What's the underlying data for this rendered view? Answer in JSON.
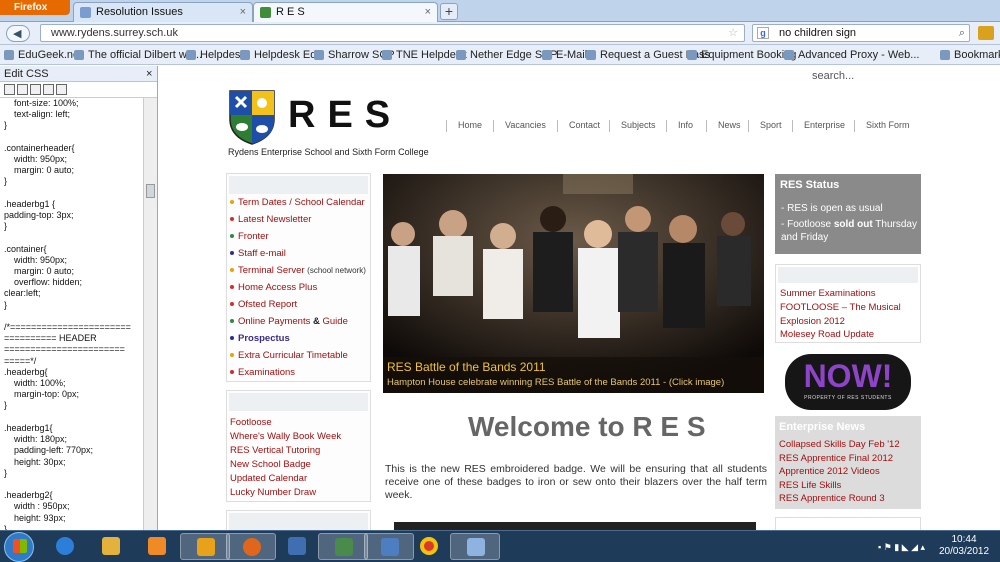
{
  "browser": {
    "app_button": "Firefox",
    "tabs": [
      {
        "label": "Resolution Issues"
      },
      {
        "label": "R E S"
      }
    ],
    "new_tab": "+",
    "url": "www.rydens.surrey.sch.uk",
    "search_value": "no children sign",
    "bookmarks": [
      "EduGeek.net",
      "The official Dilbert we...",
      "Helpdesk",
      "Helpdesk Edit",
      "Sharrow SCP",
      "TNE Helpdesk",
      "Nether Edge SCP",
      "E-Mail",
      "Request a Guest Pass",
      "Equipment Booking",
      "Advanced Proxy - Web..."
    ],
    "bookmarks_menu": "Bookmarks"
  },
  "sidebar": {
    "title": "Edit CSS",
    "close": "×",
    "code": "    font-size: 100%;\n    text-align: left;\n}\n\n.containerheader{\n    width: 950px;\n    margin: 0 auto;\n}\n\n.headerbg1 {\npadding-top: 3px;\n}\n\n.container{\n    width: 950px;\n    margin: 0 auto;\n    overflow: hidden;\nclear:left;\n}\n\n/*=======================\n========== HEADER\n=======================\n=====*/\n.headerbg{\n    width: 100%;\n    margin-top: 0px;\n}\n\n.headerbg1{\n    width: 180px;\n    padding-left: 770px;\n    height: 30px;\n}\n\n.headerbg2{\n    width : 950px;\n    height: 93px;\n}"
  },
  "site": {
    "search_placeholder": "search...",
    "logo_text": "RES",
    "tagline": "Rydens Enterprise School and Sixth Form College",
    "nav": [
      "Home",
      "Vacancies",
      "Contact",
      "Subjects",
      "Info",
      "News",
      "Sport",
      "Enterprise",
      "Sixth Form"
    ],
    "quick_links": [
      {
        "text": "Term Dates / School Calendar",
        "dot": "#e8a300"
      },
      {
        "text": "Latest Newsletter",
        "dot": "#d62b2b"
      },
      {
        "text": "Fronter",
        "dot": "#2e8b3e"
      },
      {
        "text": "Staff e-mail",
        "dot": "#2b2b9a"
      },
      {
        "text": "Terminal Server",
        "suffix": "(school network)",
        "dot": "#e8a300"
      },
      {
        "text": "Home Access Plus",
        "dot": "#d62b2b"
      },
      {
        "text": "Ofsted Report",
        "dot": "#d62b2b"
      },
      {
        "text": "Online Payments",
        "amp": "&",
        "after": "Guide",
        "dot": "#2e8b3e"
      },
      {
        "text": "Prospectus",
        "dot": "#2b2b9a"
      },
      {
        "text": "Extra Curricular Timetable",
        "dot": "#e8a300"
      },
      {
        "text": "Examinations",
        "dot": "#d62b2b"
      }
    ],
    "latest_links": [
      "Footloose",
      "Where's Wally Book Week",
      "RES Vertical Tutoring",
      "New School Badge",
      "Updated Calendar",
      "Lucky Number Draw"
    ],
    "hero": {
      "title": "RES Battle of the Bands 2011",
      "subtitle": "Hampton House celebrate winning RES Battle of the Bands 2011 - (Click image)"
    },
    "welcome": "Welcome to R E S",
    "intro": "This is the new RES embroidered badge. We will be ensuring that all students receive one of these badges to iron or sew onto their blazers over the half term week.",
    "status": {
      "title": "RES Status",
      "line1": "- RES is open as usual",
      "line2_pre": "- Footloose ",
      "line2_bold": "sold out",
      "line2_post": " Thursday and Friday"
    },
    "news_links": [
      "Summer Examinations",
      "FOOTLOOSE – The Musical",
      "Explosion 2012",
      "Molesey Road Update"
    ],
    "now_badge": {
      "text": "NOW!",
      "sub": "PROPERTY OF RES STUDENTS"
    },
    "enterprise": {
      "title": "Enterprise News",
      "links": [
        "Collapsed Skills Day Feb '12",
        "RES Apprentice Final 2012",
        "Apprentice 2012 Videos",
        "RES Life Skills",
        "RES Apprentice Round 3"
      ]
    }
  },
  "taskbar": {
    "time": "10:44",
    "date": "20/03/2012"
  }
}
